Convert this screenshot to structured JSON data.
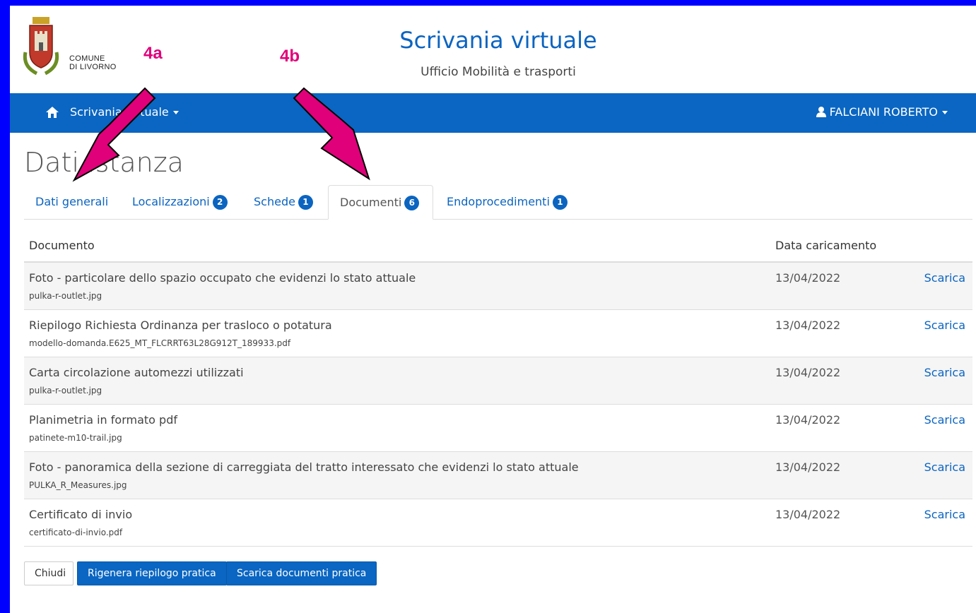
{
  "header": {
    "logo_text": [
      "COMUNE",
      "DI LIVORNO"
    ],
    "title": "Scrivania virtuale",
    "subtitle": "Ufficio Mobilità e trasporti"
  },
  "navbar": {
    "menu_label": "Scrivania virtuale",
    "user_name": "FALCIANI ROBERTO"
  },
  "page": {
    "title": "Dati istanza"
  },
  "tabs": [
    {
      "label": "Dati generali",
      "badge": null,
      "active": false
    },
    {
      "label": "Localizzazioni",
      "badge": "2",
      "active": false
    },
    {
      "label": "Schede",
      "badge": "1",
      "active": false
    },
    {
      "label": "Documenti",
      "badge": "6",
      "active": true
    },
    {
      "label": "Endoprocedimenti",
      "badge": "1",
      "active": false
    }
  ],
  "table": {
    "headers": {
      "document": "Documento",
      "date": "Data caricamento"
    },
    "rows": [
      {
        "title": "Foto - particolare dello spazio occupato che evidenzi lo stato attuale",
        "file": "pulka-r-outlet.jpg",
        "date": "13/04/2022",
        "action": "Scarica"
      },
      {
        "title": "Riepilogo Richiesta Ordinanza per trasloco o potatura",
        "file": "modello-domanda.E625_MT_FLCRRT63L28G912T_189933.pdf",
        "date": "13/04/2022",
        "action": "Scarica"
      },
      {
        "title": "Carta circolazione automezzi utilizzati",
        "file": "pulka-r-outlet.jpg",
        "date": "13/04/2022",
        "action": "Scarica"
      },
      {
        "title": "Planimetria in formato pdf",
        "file": "patinete-m10-trail.jpg",
        "date": "13/04/2022",
        "action": "Scarica"
      },
      {
        "title": "Foto - panoramica della sezione di carreggiata del tratto interessato che evidenzi lo stato attuale",
        "file": "PULKA_R_Measures.jpg",
        "date": "13/04/2022",
        "action": "Scarica"
      },
      {
        "title": "Certificato di invio",
        "file": "certificato-di-invio.pdf",
        "date": "13/04/2022",
        "action": "Scarica"
      }
    ]
  },
  "actions": {
    "close": "Chiudi",
    "regenerate": "Rigenera riepilogo pratica",
    "download_all": "Scarica documenti pratica"
  },
  "annotations": [
    "4a",
    "4b"
  ],
  "colors": {
    "brand": "#0a66c2",
    "annotation": "#e0007a",
    "frame": "#0000ff"
  }
}
